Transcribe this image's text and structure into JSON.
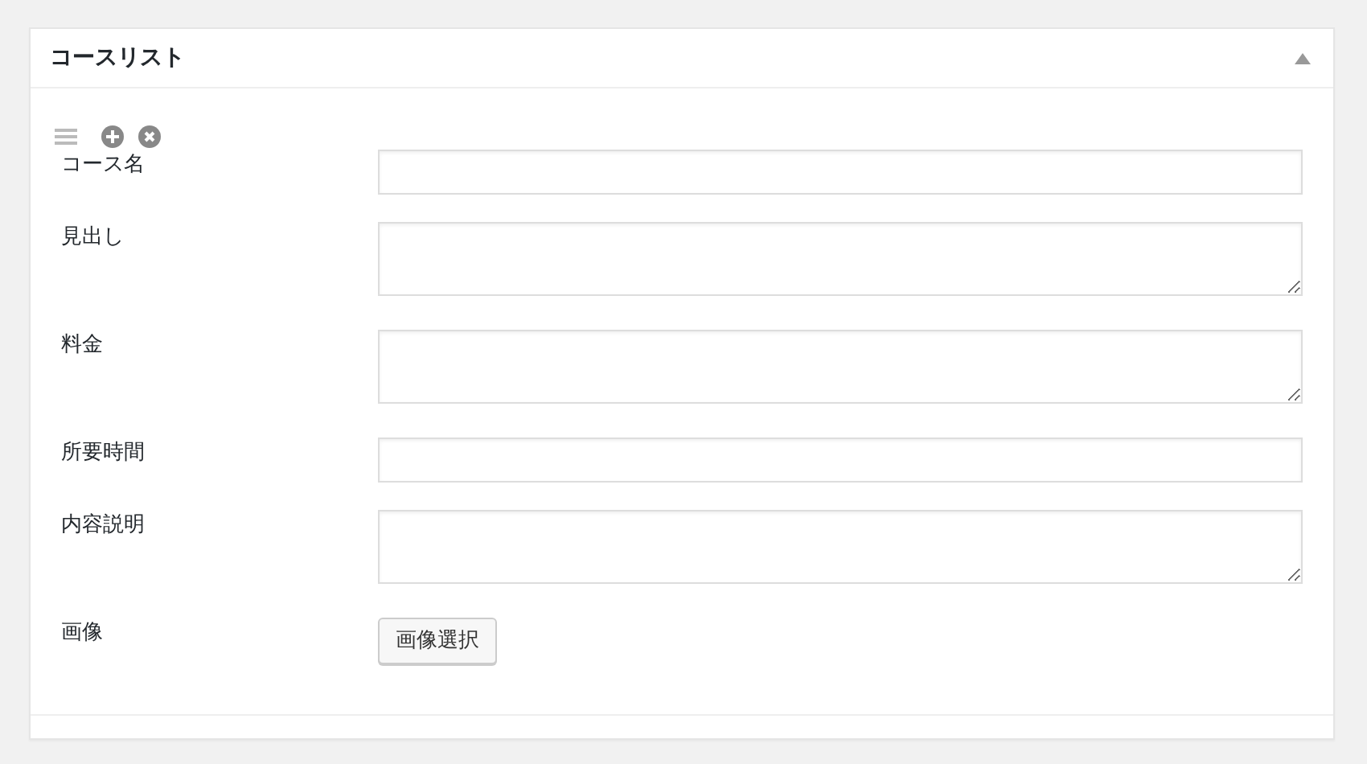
{
  "panel": {
    "title": "コースリスト",
    "expanded": true
  },
  "fields": [
    {
      "label": "コース名",
      "kind": "text"
    },
    {
      "label": "見出し",
      "kind": "textarea"
    },
    {
      "label": "料金",
      "kind": "textarea"
    },
    {
      "label": "所要時間",
      "kind": "text"
    },
    {
      "label": "内容説明",
      "kind": "textarea"
    },
    {
      "label": "画像",
      "kind": "button",
      "button": "画像選択"
    }
  ]
}
